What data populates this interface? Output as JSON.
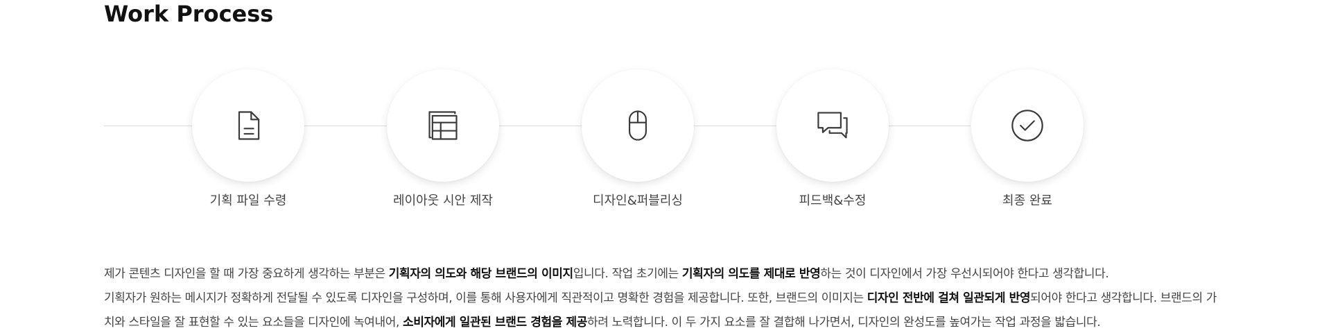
{
  "section": {
    "title": "Work Process"
  },
  "steps": [
    {
      "label": "기획 파일 수령",
      "icon": "document-icon"
    },
    {
      "label": "레이아웃 시안 제작",
      "icon": "layout-icon"
    },
    {
      "label": "디자인&퍼블리싱",
      "icon": "mouse-icon"
    },
    {
      "label": "피드백&수정",
      "icon": "chat-icon"
    },
    {
      "label": "최종 완료",
      "icon": "check-circle-icon"
    }
  ],
  "description": {
    "line1": {
      "t1": "제가 콘텐츠 디자인을 할 때 가장 중요하게 생각하는 부분은 ",
      "b1": "기획자의 의도와 해당 브랜드의 이미지",
      "t2": "입니다. 작업 초기에는 ",
      "b2": "기획자의 의도를 제대로 반영",
      "t3": "하는 것이 디자인에서 가장 우선시되어야 한다고 생각합니다."
    },
    "line2": {
      "t1": "기획자가 원하는 메시지가 정확하게 전달될 수 있도록 디자인을 구성하며, 이를 통해 사용자에게 직관적이고 명확한 경험을 제공합니다. 또한, 브랜드의 이미지는 ",
      "b1": "디자인 전반에 걸쳐 일관되게 반영",
      "t2": "되어야 한다고 생각합니다. 브랜드의 가"
    },
    "line3": {
      "t1": "치와 스타일을 잘 표현할 수 있는 요소들을 디자인에 녹여내어, ",
      "b1": "소비자에게 일관된 브랜드 경험을 제공",
      "t2": "하려 노력합니다. 이 두 가지 요소를 잘 결합해 나가면서, 디자인의 완성도를 높여가는 작업 과정을 밟습니다."
    }
  },
  "colors": {
    "icon": "#3a3a3a",
    "line": "#dcdcdc",
    "text": "#444444",
    "title": "#111111"
  }
}
